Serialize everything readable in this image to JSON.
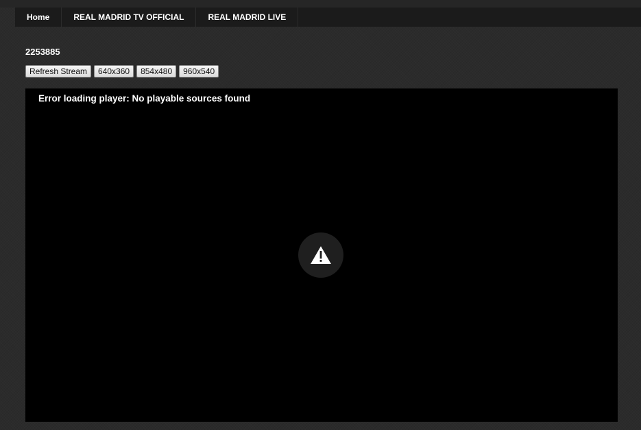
{
  "nav": {
    "items": [
      {
        "label": "Home"
      },
      {
        "label": "REAL MADRID TV OFFICIAL"
      },
      {
        "label": "REAL MADRID LIVE"
      }
    ]
  },
  "page": {
    "title": "2253885"
  },
  "controls": {
    "refresh_label": "Refresh Stream",
    "size_640_label": "640x360",
    "size_854_label": "854x480",
    "size_960_label": "960x540"
  },
  "player": {
    "error_message": "Error loading player: No playable sources found",
    "icon": "warning-triangle-icon"
  },
  "colors": {
    "background": "#2b2b2b",
    "navbar": "#1b1b1b",
    "player_bg": "#000000",
    "icon_circle": "#1f1f1f"
  }
}
